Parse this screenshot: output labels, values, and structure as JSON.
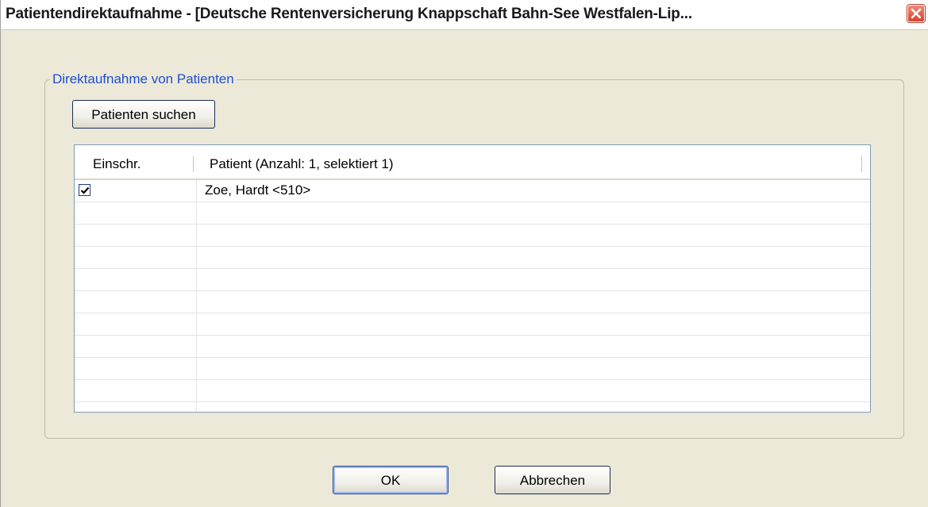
{
  "window": {
    "title": "Patientendirektaufnahme - [Deutsche Rentenversicherung Knappschaft Bahn-See Westfalen-Lip...",
    "close_icon": "close-icon"
  },
  "group": {
    "legend": "Direktaufnahme von Patienten"
  },
  "toolbar": {
    "search_label": "Patienten suchen"
  },
  "table": {
    "columns": [
      "Einschr.",
      "Patient (Anzahl: 1, selektiert 1)"
    ],
    "rows": [
      {
        "checked": true,
        "patient": "Zoe,  Hardt <510>"
      }
    ]
  },
  "footer": {
    "ok_label": "OK",
    "cancel_label": "Abbrechen"
  },
  "colors": {
    "window_bg": "#ece9d8",
    "legend": "#1f4fd0",
    "close": "#d8412a"
  }
}
